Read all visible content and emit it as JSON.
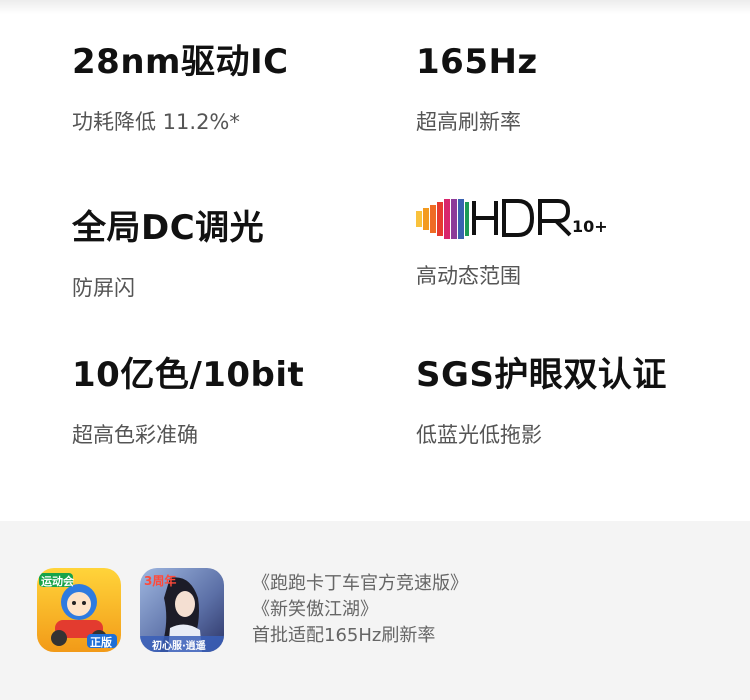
{
  "features": [
    {
      "title": "28nm驱动IC",
      "subtitle": "功耗降低 11.2%*"
    },
    {
      "title": "165Hz",
      "subtitle": "超高刷新率"
    },
    {
      "title": "全局DC调光",
      "subtitle": "防屏闪"
    },
    {
      "logo": "HDR10+",
      "subtitle": "高动态范围"
    },
    {
      "title": "10亿色/10bit",
      "subtitle": "超高色彩准确"
    },
    {
      "title": "SGS护眼双认证",
      "subtitle": "低蓝光低拖影"
    }
  ],
  "games": {
    "line1": "《跑跑卡丁车官方竞速版》",
    "line2": "《新笑傲江湖》",
    "line3": "首批适配165Hz刷新率",
    "icon1_badge_top": "运动会",
    "icon1_badge_bottom": "正版",
    "icon2_badge_top": "3周年",
    "icon2_badge_bottom": "初心服·逍遥"
  },
  "colors": {
    "bottom_bg": "#f4f4f4",
    "subtitle": "#555555"
  }
}
